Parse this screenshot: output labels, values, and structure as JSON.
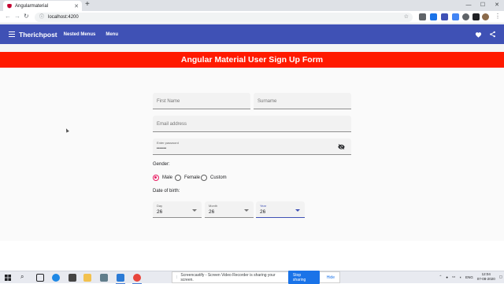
{
  "browser": {
    "tab_title": "Angularmaterial",
    "new_tab": "+",
    "url": "localhost:4200",
    "controls": {
      "minimize": "—",
      "maximize": "☐",
      "close": "✕"
    }
  },
  "app": {
    "brand": "Therichpost",
    "nav": [
      "Nested Menus",
      "Menu"
    ]
  },
  "banner": {
    "title": "Angular Material User Sign Up Form"
  },
  "form": {
    "first_name": {
      "placeholder": "First Name"
    },
    "surname": {
      "placeholder": "Surname"
    },
    "email": {
      "placeholder": "Email address"
    },
    "password": {
      "label": "Enter password",
      "value": "••••••"
    },
    "gender": {
      "label": "Gender:",
      "options": [
        "Male",
        "Female",
        "Custom"
      ],
      "selected": "Male"
    },
    "dob": {
      "label": "Date of birth:",
      "day": {
        "label": "Day",
        "value": "26"
      },
      "month": {
        "label": "Month",
        "value": "26"
      },
      "year": {
        "label": "Year",
        "value": "26"
      }
    }
  },
  "screen_share": {
    "message": "Screencastify - Screen Video Recorder is sharing your screen.",
    "stop": "Stop sharing",
    "hide": "Hide"
  },
  "taskbar": {
    "lang": "ENG",
    "time": "12:04",
    "date": "07-08-2020"
  },
  "colors": {
    "primary": "#3f51b5",
    "banner": "#ff1a00",
    "accent": "#e91e63"
  }
}
